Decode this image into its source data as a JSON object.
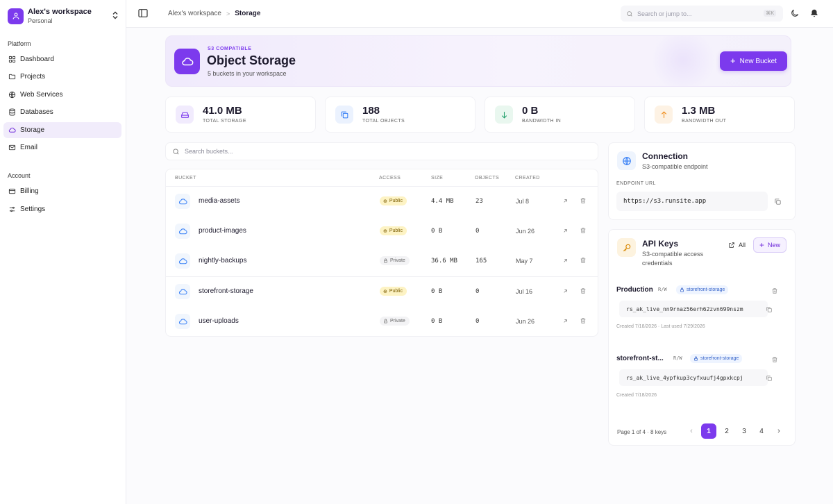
{
  "workspace": {
    "name": "Alex's workspace",
    "plan": "Personal"
  },
  "sidebar": {
    "platform_label": "Platform",
    "account_label": "Account",
    "platform_items": [
      {
        "label": "Dashboard",
        "icon": "dashboard-icon"
      },
      {
        "label": "Projects",
        "icon": "folder-icon"
      },
      {
        "label": "Web Services",
        "icon": "globe-icon"
      },
      {
        "label": "Databases",
        "icon": "database-icon"
      },
      {
        "label": "Storage",
        "icon": "cloud-icon",
        "active": true
      },
      {
        "label": "Email",
        "icon": "mail-icon"
      }
    ],
    "account_items": [
      {
        "label": "Billing",
        "icon": "credit-card-icon"
      },
      {
        "label": "Settings",
        "icon": "sliders-icon"
      }
    ]
  },
  "topbar": {
    "breadcrumb": [
      "Alex's workspace",
      "Storage"
    ],
    "breadcrumb_sep": ">",
    "search_placeholder": "Search or jump to...",
    "search_shortcut": "⌘K"
  },
  "hero": {
    "eyebrow": "S3 COMPATIBLE",
    "title": "Object Storage",
    "subtitle": "5 buckets in your workspace",
    "new_bucket_label": "New Bucket"
  },
  "stats": [
    {
      "value": "41.0 MB",
      "label": "TOTAL STORAGE",
      "icon": "hard-drive-icon",
      "color": "#7c3aed"
    },
    {
      "value": "188",
      "label": "TOTAL OBJECTS",
      "icon": "copy-icon",
      "color": "#3b82f6"
    },
    {
      "value": "0 B",
      "label": "BANDWIDTH IN",
      "icon": "arrow-down-icon",
      "color": "#22a06b"
    },
    {
      "value": "1.3 MB",
      "label": "BANDWIDTH OUT",
      "icon": "arrow-up-icon",
      "color": "#f08c1a"
    }
  ],
  "bucket_search_placeholder": "Search buckets...",
  "table": {
    "headers": [
      "BUCKET",
      "ACCESS",
      "SIZE",
      "OBJECTS",
      "CREATED"
    ],
    "rows": [
      {
        "name": "media-assets",
        "access": "Public",
        "size": "4.4 MB",
        "objects": "23",
        "created": "Jul 8"
      },
      {
        "name": "product-images",
        "access": "Public",
        "size": "0 B",
        "objects": "0",
        "created": "Jun 26"
      },
      {
        "name": "nightly-backups",
        "access": "Private",
        "size": "36.6 MB",
        "objects": "165",
        "created": "May 7"
      },
      {
        "name": "storefront-storage",
        "access": "Public",
        "size": "0 B",
        "objects": "0",
        "created": "Jul 16"
      },
      {
        "name": "user-uploads",
        "access": "Private",
        "size": "0 B",
        "objects": "0",
        "created": "Jun 26"
      }
    ]
  },
  "connection": {
    "title": "Connection",
    "subtitle": "S3-compatible endpoint",
    "endpoint_label": "ENDPOINT URL",
    "endpoint_url": "https://s3.runsite.app"
  },
  "api_keys": {
    "title": "API Keys",
    "subtitle": "S3-compatible access credentials",
    "all_label": "All",
    "new_label": "New",
    "keys": [
      {
        "name": "Production",
        "perm": "R/W",
        "scope": "storefront-storage",
        "key": "rs_ak_live_nn9rnaz56erh62zvn699nszm",
        "meta": "Created 7/18/2026 · Last used 7/29/2026"
      },
      {
        "name": "storefront-st...",
        "perm": "R/W",
        "scope": "storefront-storage",
        "key": "rs_ak_live_4ypfkup3cyfxuufj4gpxkcpj",
        "meta": "Created 7/18/2026"
      }
    ],
    "pagination": {
      "label": "Page 1 of 4 · 8 keys",
      "pages": [
        "1",
        "2",
        "3",
        "4"
      ],
      "current": "1",
      "prev": "‹",
      "next": "›"
    }
  },
  "colors": {
    "accent": "#7c3aed",
    "public_badge": "#fdf3c4",
    "private_badge": "#f3f3f5"
  }
}
